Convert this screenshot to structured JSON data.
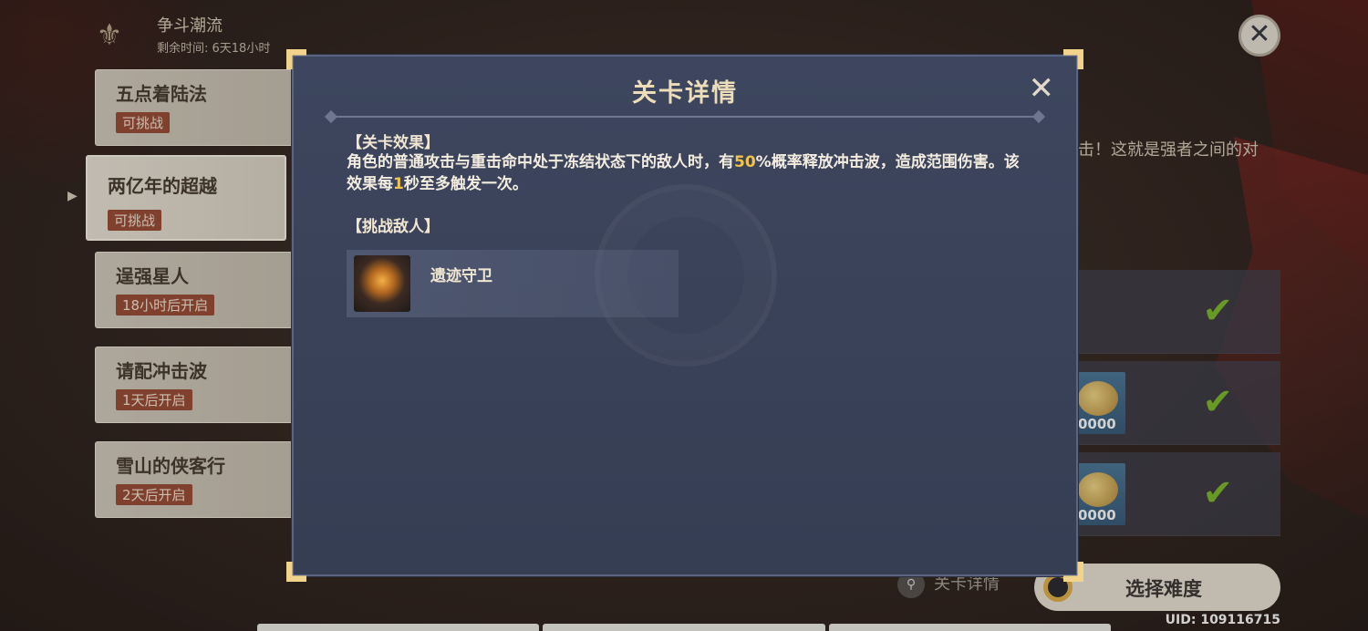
{
  "event": {
    "title": "争斗潮流",
    "time_left": "剩余时间: 6天18小时"
  },
  "stages": [
    {
      "name": "五点着陆法",
      "status": "可挑战"
    },
    {
      "name": "两亿年的超越",
      "status": "可挑战"
    },
    {
      "name": "逞强星人",
      "status": "18小时后开启"
    },
    {
      "name": "请配冲击波",
      "status": "1天后开启"
    },
    {
      "name": "雪山的侠客行",
      "status": "2天后开启"
    }
  ],
  "right_panel": {
    "desc_fragment": "击！这就是强者之间的对",
    "rewards": [
      {
        "count": "",
        "claimed": true
      },
      {
        "count": "0000",
        "claimed": true
      },
      {
        "count": "0000",
        "claimed": true
      }
    ]
  },
  "footer": {
    "detail_label": "关卡详情",
    "choose_label": "选择难度",
    "uid": "UID: 109116715"
  },
  "modal": {
    "title": "关卡详情",
    "effect_heading": "【关卡效果】",
    "effect_part1": "角色的普通攻击与重击命中处于冻结状态下的敌人时，有",
    "effect_pct": "50",
    "effect_part2": "%概率释放冲击波，造成范围伤害。该效果每",
    "effect_num": "1",
    "effect_part3": "秒至多触发一次。",
    "enemies_heading": "【挑战敌人】",
    "enemies": [
      {
        "name": "遗迹守卫"
      }
    ]
  },
  "icons": {
    "top_close": "close-icon",
    "modal_close": "close-icon",
    "check": "check-icon",
    "search": "search-icon"
  },
  "colors": {
    "highlight": "#f3c34a",
    "stage_tag": "#9b4f38",
    "check": "#7fba2f"
  }
}
